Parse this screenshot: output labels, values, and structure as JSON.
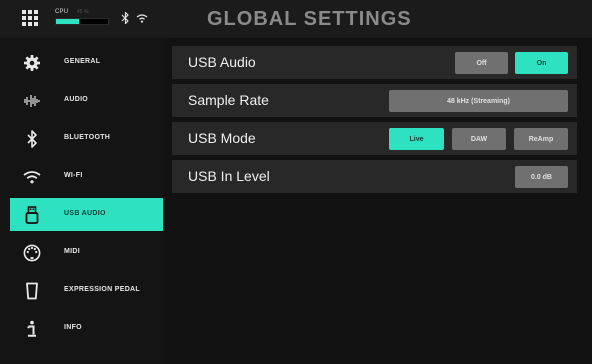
{
  "header": {
    "title": "GLOBAL SETTINGS",
    "cpu_label": "CPU",
    "cpu_percent_text": "45 %",
    "cpu_fill_fraction": 0.45,
    "accent_color": "#2ee1c1"
  },
  "sidebar": {
    "items": [
      {
        "label": "GENERAL",
        "icon": "gear-icon",
        "active": false
      },
      {
        "label": "AUDIO",
        "icon": "waveform-icon",
        "active": false
      },
      {
        "label": "BLUETOOTH",
        "icon": "bluetooth-icon",
        "active": false
      },
      {
        "label": "WI-FI",
        "icon": "wifi-icon",
        "active": false
      },
      {
        "label": "USB AUDIO",
        "icon": "usb-icon",
        "active": true
      },
      {
        "label": "MIDI",
        "icon": "midi-icon",
        "active": false
      },
      {
        "label": "EXPRESSION PEDAL",
        "icon": "expression-pedal-icon",
        "active": false
      },
      {
        "label": "INFO",
        "icon": "info-icon",
        "active": false
      }
    ]
  },
  "settings": {
    "usb_audio": {
      "label": "USB Audio",
      "off_label": "Off",
      "on_label": "On",
      "selected": "On"
    },
    "sample_rate": {
      "label": "Sample Rate",
      "value": "48 kHz (Streaming)"
    },
    "usb_mode": {
      "label": "USB Mode",
      "options": [
        "Live",
        "DAW",
        "ReAmp"
      ],
      "selected": "Live"
    },
    "usb_in_level": {
      "label": "USB In Level",
      "value": "0.0 dB"
    }
  }
}
